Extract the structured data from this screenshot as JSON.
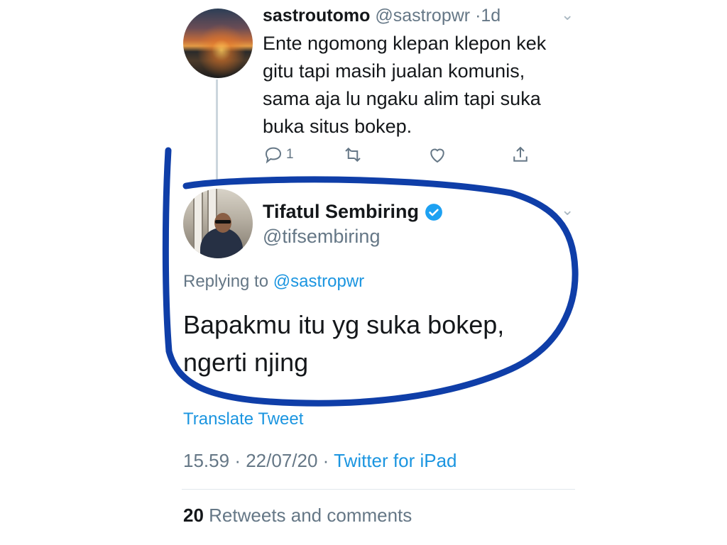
{
  "reply_tweet": {
    "display_name": "sastroutomo",
    "handle": "@sastropwr",
    "age": "1d",
    "separator": "·",
    "body_lines": [
      "Ente ngomong klepan klepon kek",
      "gitu tapi masih jualan komunis,",
      "sama aja lu ngaku alim tapi suka",
      "buka situs  bokep."
    ],
    "reply_count": "1",
    "icons": [
      "reply-icon",
      "retweet-icon",
      "like-icon",
      "share-icon"
    ]
  },
  "main_tweet": {
    "display_name": "Tifatul Sembiring",
    "handle": "@tifsembiring",
    "verified": true,
    "replying_prefix": "Replying to",
    "replying_to": "@sastropwr",
    "body_lines": [
      "Bapakmu itu yg suka bokep,",
      "ngerti njing"
    ],
    "translate_label": "Translate Tweet",
    "time": "15.59",
    "date": "22/07/20",
    "source": "Twitter for iPad",
    "separator": "·",
    "retweet_count": "20",
    "retweet_label": "Retweets and comments"
  },
  "colors": {
    "link": "#1b95e0",
    "secondary_text": "#657786",
    "annotation_ink": "#0f3ea8"
  }
}
